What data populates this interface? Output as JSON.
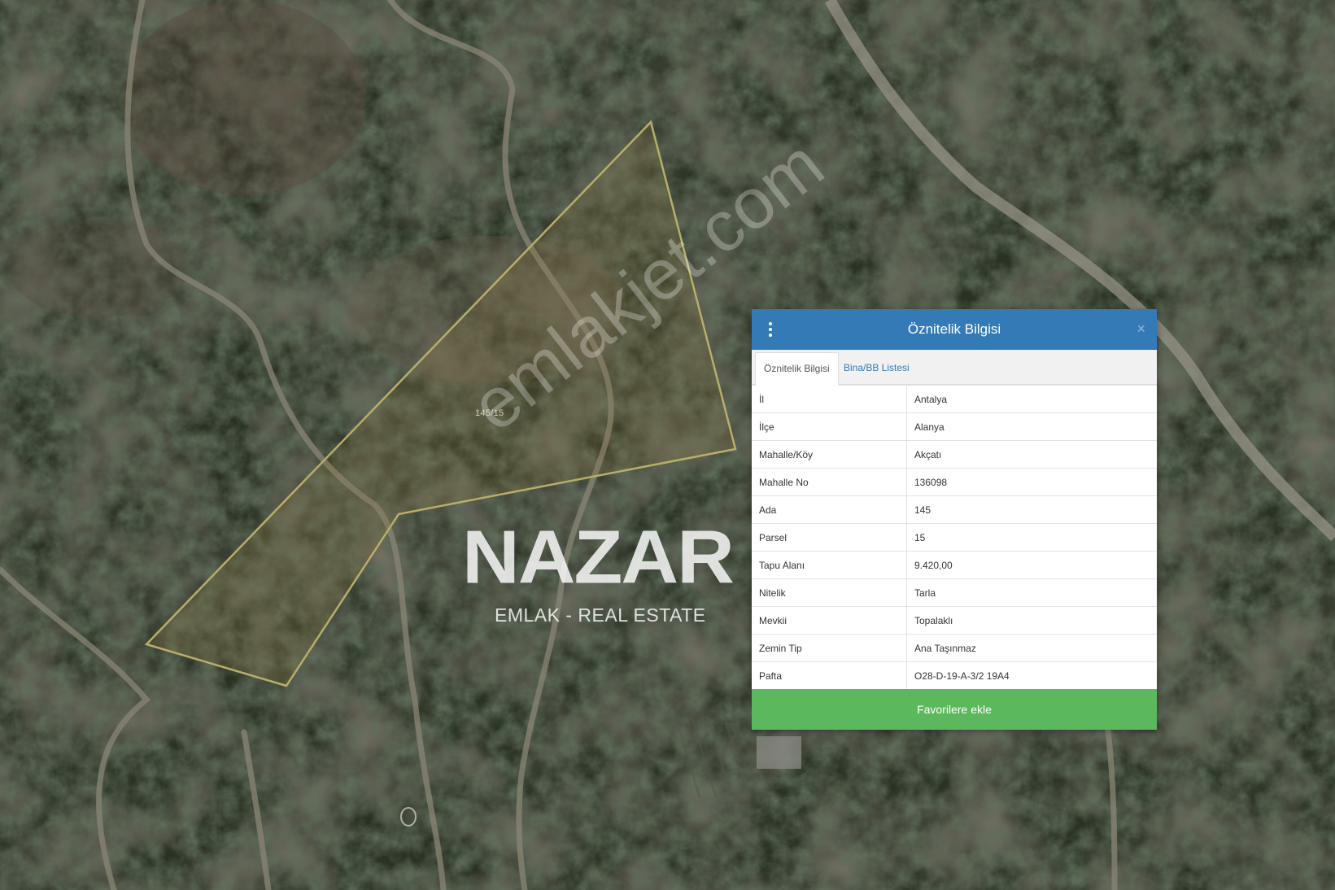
{
  "map": {
    "parcel_label": "145/15",
    "watermark_brand": "NAZAR",
    "watermark_tagline": "EMLAK - REAL ESTATE",
    "watermark_site": "emlakjet.com",
    "parcel_outline_color": "#b9ad6a"
  },
  "panel": {
    "title": "Öznitelik Bilgisi",
    "close_symbol": "×",
    "menu_icon": "more-vertical-icon",
    "tabs": [
      {
        "label": "Öznitelik Bilgisi",
        "active": true
      },
      {
        "label": "Bina/BB Listesi",
        "active": false
      }
    ],
    "rows": [
      {
        "key": "İl",
        "value": "Antalya"
      },
      {
        "key": "İlçe",
        "value": "Alanya"
      },
      {
        "key": "Mahalle/Köy",
        "value": "Akçatı"
      },
      {
        "key": "Mahalle No",
        "value": "136098"
      },
      {
        "key": "Ada",
        "value": "145"
      },
      {
        "key": "Parsel",
        "value": "15"
      },
      {
        "key": "Tapu Alanı",
        "value": "9.420,00"
      },
      {
        "key": "Nitelik",
        "value": "Tarla"
      },
      {
        "key": "Mevkii",
        "value": "Topalaklı"
      },
      {
        "key": "Zemin Tip",
        "value": "Ana Taşınmaz"
      },
      {
        "key": "Pafta",
        "value": "O28-D-19-A-3/2 19A4"
      }
    ],
    "favorite_button": "Favorilere ekle",
    "colors": {
      "header": "#337ab7",
      "button": "#5cb85c",
      "tab_link": "#337ab7"
    }
  }
}
